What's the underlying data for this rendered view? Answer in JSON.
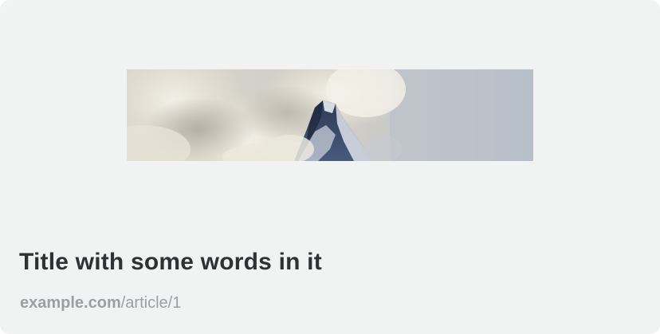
{
  "card": {
    "title": "Title with some words in it",
    "link": {
      "domain": "example.com",
      "path": "/article/1"
    },
    "image": {
      "subject": "mountain-peak-in-clouds"
    }
  },
  "colors": {
    "card_background": "#f1f2f2",
    "title_text": "#2f3133",
    "link_text": "#9b9fa3"
  }
}
